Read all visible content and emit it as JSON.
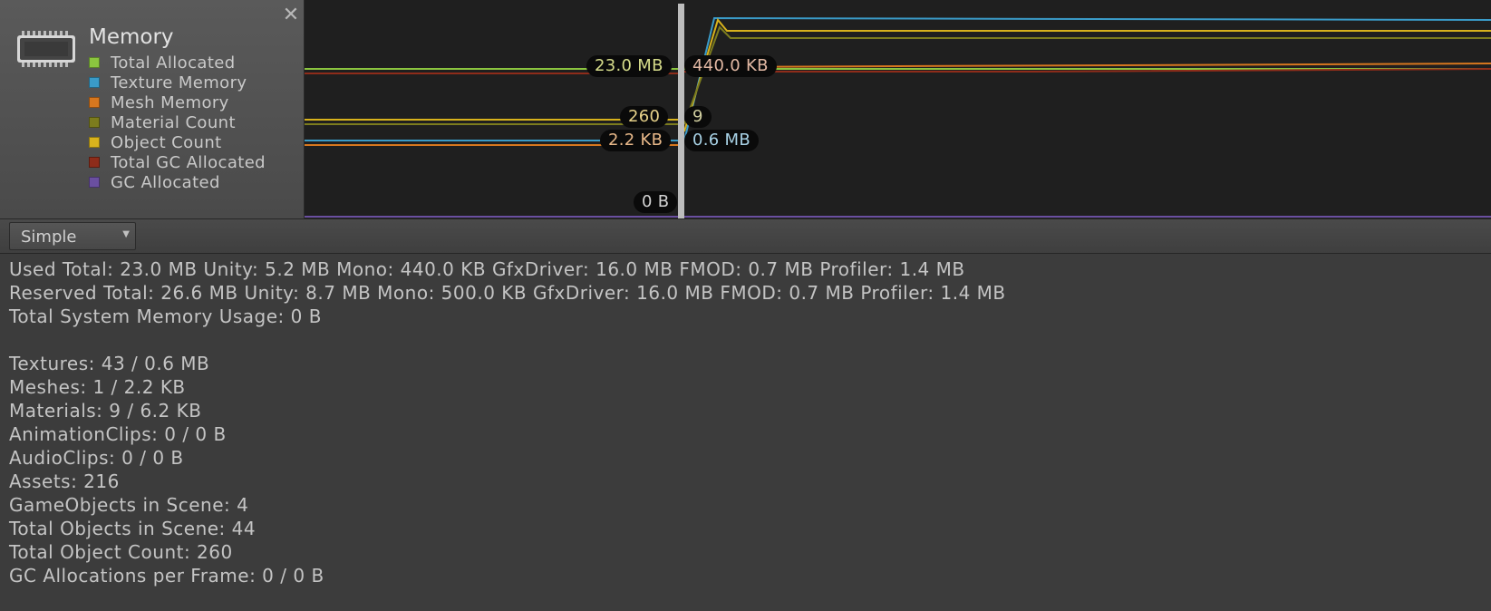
{
  "legend": {
    "title": "Memory",
    "close_symbol": "✕",
    "icon": "memory-chip-icon",
    "items": [
      {
        "label": "Total Allocated",
        "color": "#8bc53f"
      },
      {
        "label": "Texture Memory",
        "color": "#3a9bc8"
      },
      {
        "label": "Mesh Memory",
        "color": "#d7771e"
      },
      {
        "label": "Material Count",
        "color": "#7c7c1e"
      },
      {
        "label": "Object Count",
        "color": "#d8b21c"
      },
      {
        "label": "Total GC Allocated",
        "color": "#8e2c1a"
      },
      {
        "label": "GC Allocated",
        "color": "#6a4fa0"
      }
    ]
  },
  "chart": {
    "left_labels": {
      "total_allocated": "23.0 MB",
      "object_count": "260",
      "mesh_memory": "2.2 KB",
      "gc_allocated": "0 B"
    },
    "right_labels": {
      "mono": "440.0 KB",
      "material_count": "9",
      "texture_memory": "0.6 MB"
    }
  },
  "toolbar": {
    "view_mode": "Simple"
  },
  "details": {
    "used_total": "Used Total: 23.0 MB   Unity: 5.2 MB   Mono: 440.0 KB   GfxDriver: 16.0 MB   FMOD: 0.7 MB   Profiler: 1.4 MB",
    "reserved_total": "Reserved Total: 26.6 MB   Unity: 8.7 MB   Mono: 500.0 KB   GfxDriver: 16.0 MB   FMOD: 0.7 MB   Profiler: 1.4 MB",
    "system_memory": "Total System Memory Usage: 0 B",
    "textures": "Textures: 43 / 0.6 MB",
    "meshes": "Meshes: 1 / 2.2 KB",
    "materials": "Materials: 9 / 6.2 KB",
    "animation_clips": "AnimationClips: 0 / 0 B",
    "audio_clips": "AudioClips: 0 / 0 B",
    "assets": "Assets: 216",
    "gameobjects": "GameObjects in Scene: 4",
    "total_objects_scene": "Total Objects in Scene: 44",
    "total_object_count": "Total Object Count: 260",
    "gc_allocations": "GC Allocations per Frame: 0 / 0 B"
  }
}
